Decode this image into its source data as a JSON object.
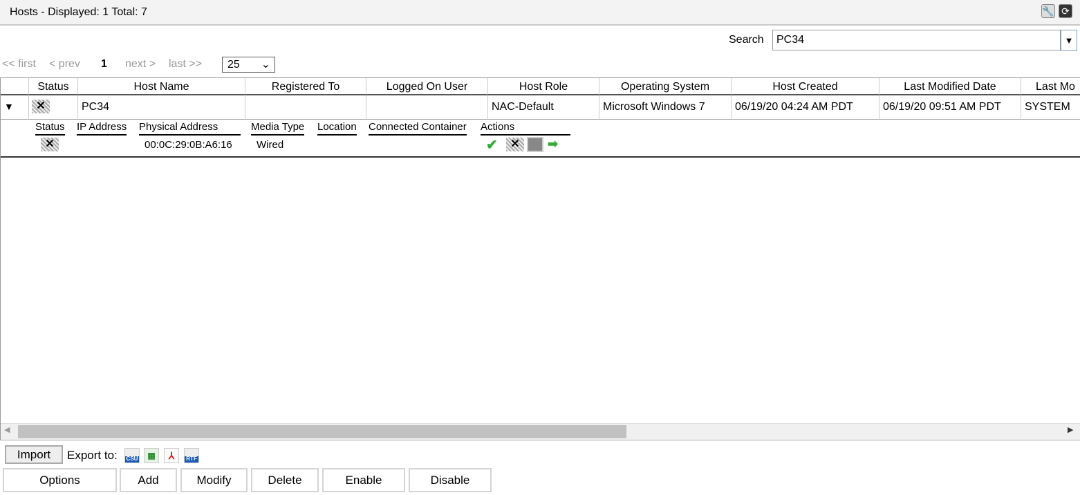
{
  "title": "Hosts - Displayed: 1 Total: 7",
  "search": {
    "label": "Search",
    "value": "PC34"
  },
  "pager": {
    "first": "<< first",
    "prev": "< prev",
    "current": "1",
    "next": "next >",
    "last": "last >>",
    "page_size": "25"
  },
  "columns": [
    "Status",
    "Host Name",
    "Registered To",
    "Logged On User",
    "Host Role",
    "Operating System",
    "Host Created",
    "Last Modified Date",
    "Last Mo"
  ],
  "row": {
    "host_name": "PC34",
    "registered_to": "",
    "logged_on_user": "",
    "host_role": "NAC-Default",
    "os": "Microsoft Windows 7",
    "created": "06/19/20 04:24 AM PDT",
    "modified": "06/19/20 09:51 AM PDT",
    "last_mod_by": "SYSTEM"
  },
  "detail": {
    "headers": [
      "Status",
      "IP Address",
      "Physical Address",
      "Media Type",
      "Location",
      "Connected Container",
      "Actions"
    ],
    "physical_address": "00:0C:29:0B:A6:16",
    "media_type": "Wired"
  },
  "export": {
    "import": "Import",
    "label": "Export to:",
    "formats": [
      "CSU",
      "XLS",
      "PDF",
      "RTF"
    ]
  },
  "buttons": [
    "Options",
    "Add",
    "Modify",
    "Delete",
    "Enable",
    "Disable"
  ]
}
